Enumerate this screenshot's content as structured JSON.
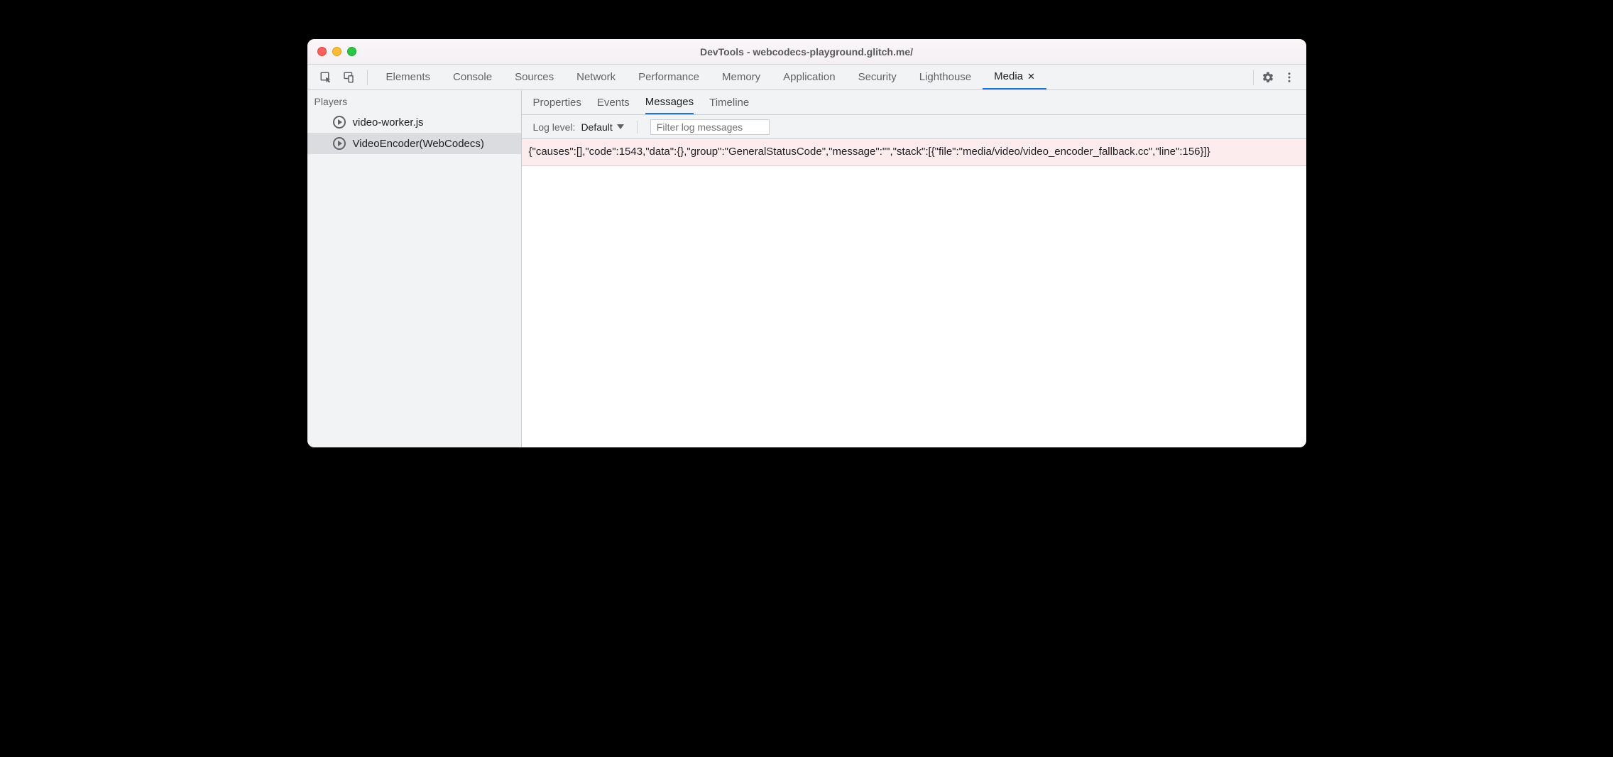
{
  "title": "DevTools - webcodecs-playground.glitch.me/",
  "topTabs": [
    {
      "label": "Elements",
      "active": false,
      "closable": false
    },
    {
      "label": "Console",
      "active": false,
      "closable": false
    },
    {
      "label": "Sources",
      "active": false,
      "closable": false
    },
    {
      "label": "Network",
      "active": false,
      "closable": false
    },
    {
      "label": "Performance",
      "active": false,
      "closable": false
    },
    {
      "label": "Memory",
      "active": false,
      "closable": false
    },
    {
      "label": "Application",
      "active": false,
      "closable": false
    },
    {
      "label": "Security",
      "active": false,
      "closable": false
    },
    {
      "label": "Lighthouse",
      "active": false,
      "closable": false
    },
    {
      "label": "Media",
      "active": true,
      "closable": true
    }
  ],
  "sidebar": {
    "heading": "Players",
    "items": [
      {
        "label": "video-worker.js",
        "selected": false
      },
      {
        "label": "VideoEncoder(WebCodecs)",
        "selected": true
      }
    ]
  },
  "subTabs": [
    {
      "label": "Properties",
      "active": false
    },
    {
      "label": "Events",
      "active": false
    },
    {
      "label": "Messages",
      "active": true
    },
    {
      "label": "Timeline",
      "active": false
    }
  ],
  "filter": {
    "logLevelLabel": "Log level:",
    "logLevelValue": "Default",
    "filterPlaceholder": "Filter log messages"
  },
  "logs": [
    "{\"causes\":[],\"code\":1543,\"data\":{},\"group\":\"GeneralStatusCode\",\"message\":\"\",\"stack\":[{\"file\":\"media/video/video_encoder_fallback.cc\",\"line\":156}]}"
  ]
}
